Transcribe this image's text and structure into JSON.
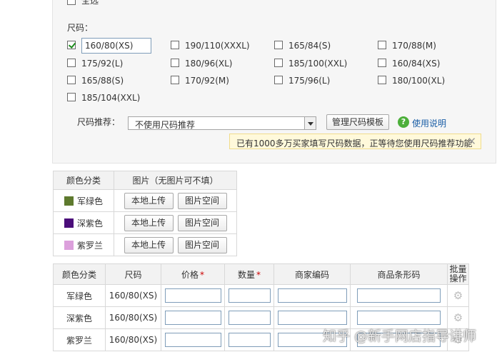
{
  "size_section": {
    "select_all_label": "全选",
    "title": "尺码：",
    "input_value": "160/80(XS)",
    "options": [
      {
        "label": "160/80(XS)",
        "checked": true
      },
      {
        "label": "190/110(XXXL)",
        "checked": false
      },
      {
        "label": "165/84(S)",
        "checked": false
      },
      {
        "label": "170/88(M)",
        "checked": false
      },
      {
        "label": "175/92(L)",
        "checked": false
      },
      {
        "label": "180/96(XL)",
        "checked": false
      },
      {
        "label": "185/100(XXL)",
        "checked": false
      },
      {
        "label": "160/84(XS)",
        "checked": false
      },
      {
        "label": "165/88(S)",
        "checked": false
      },
      {
        "label": "170/92(M)",
        "checked": false
      },
      {
        "label": "175/96(L)",
        "checked": false
      },
      {
        "label": "180/100(XL)",
        "checked": false
      },
      {
        "label": "185/104(XXL)",
        "checked": false
      }
    ],
    "recommend_label": "尺码推荐：",
    "recommend_value": "不使用尺码推荐",
    "manage_button": "管理尺码模板",
    "help_icon_glyph": "?",
    "help_link": "使用说明",
    "tip_text": "已有1000多万买家填写尺码数据，正等待您使用尺码推荐功能",
    "tip_close": "✕"
  },
  "image_table": {
    "headers": [
      "颜色分类",
      "图片（无图片可不填）"
    ],
    "rows": [
      {
        "color": "军绿色",
        "swatch": "#5e7a2e"
      },
      {
        "color": "深紫色",
        "swatch": "#4b0e7a"
      },
      {
        "color": "紫罗兰",
        "swatch": "#dca0dc"
      }
    ],
    "upload_label": "本地上传",
    "space_label": "图片空间"
  },
  "sku_table": {
    "headers": {
      "color": "颜色分类",
      "size": "尺码",
      "price": "价格",
      "quantity": "数量",
      "code": "商家编码",
      "barcode": "商品条形码",
      "batch_line1": "批量",
      "batch_line2": "操作"
    },
    "required_mark": "*",
    "rows": [
      {
        "color": "军绿色",
        "size": "160/80(XS)"
      },
      {
        "color": "深紫色",
        "size": "160/80(XS)"
      },
      {
        "color": "紫罗兰",
        "size": "160/80(XS)"
      }
    ],
    "gear_glyph": "⚙"
  },
  "watermark": "知乎 @新手网店指导讲师"
}
